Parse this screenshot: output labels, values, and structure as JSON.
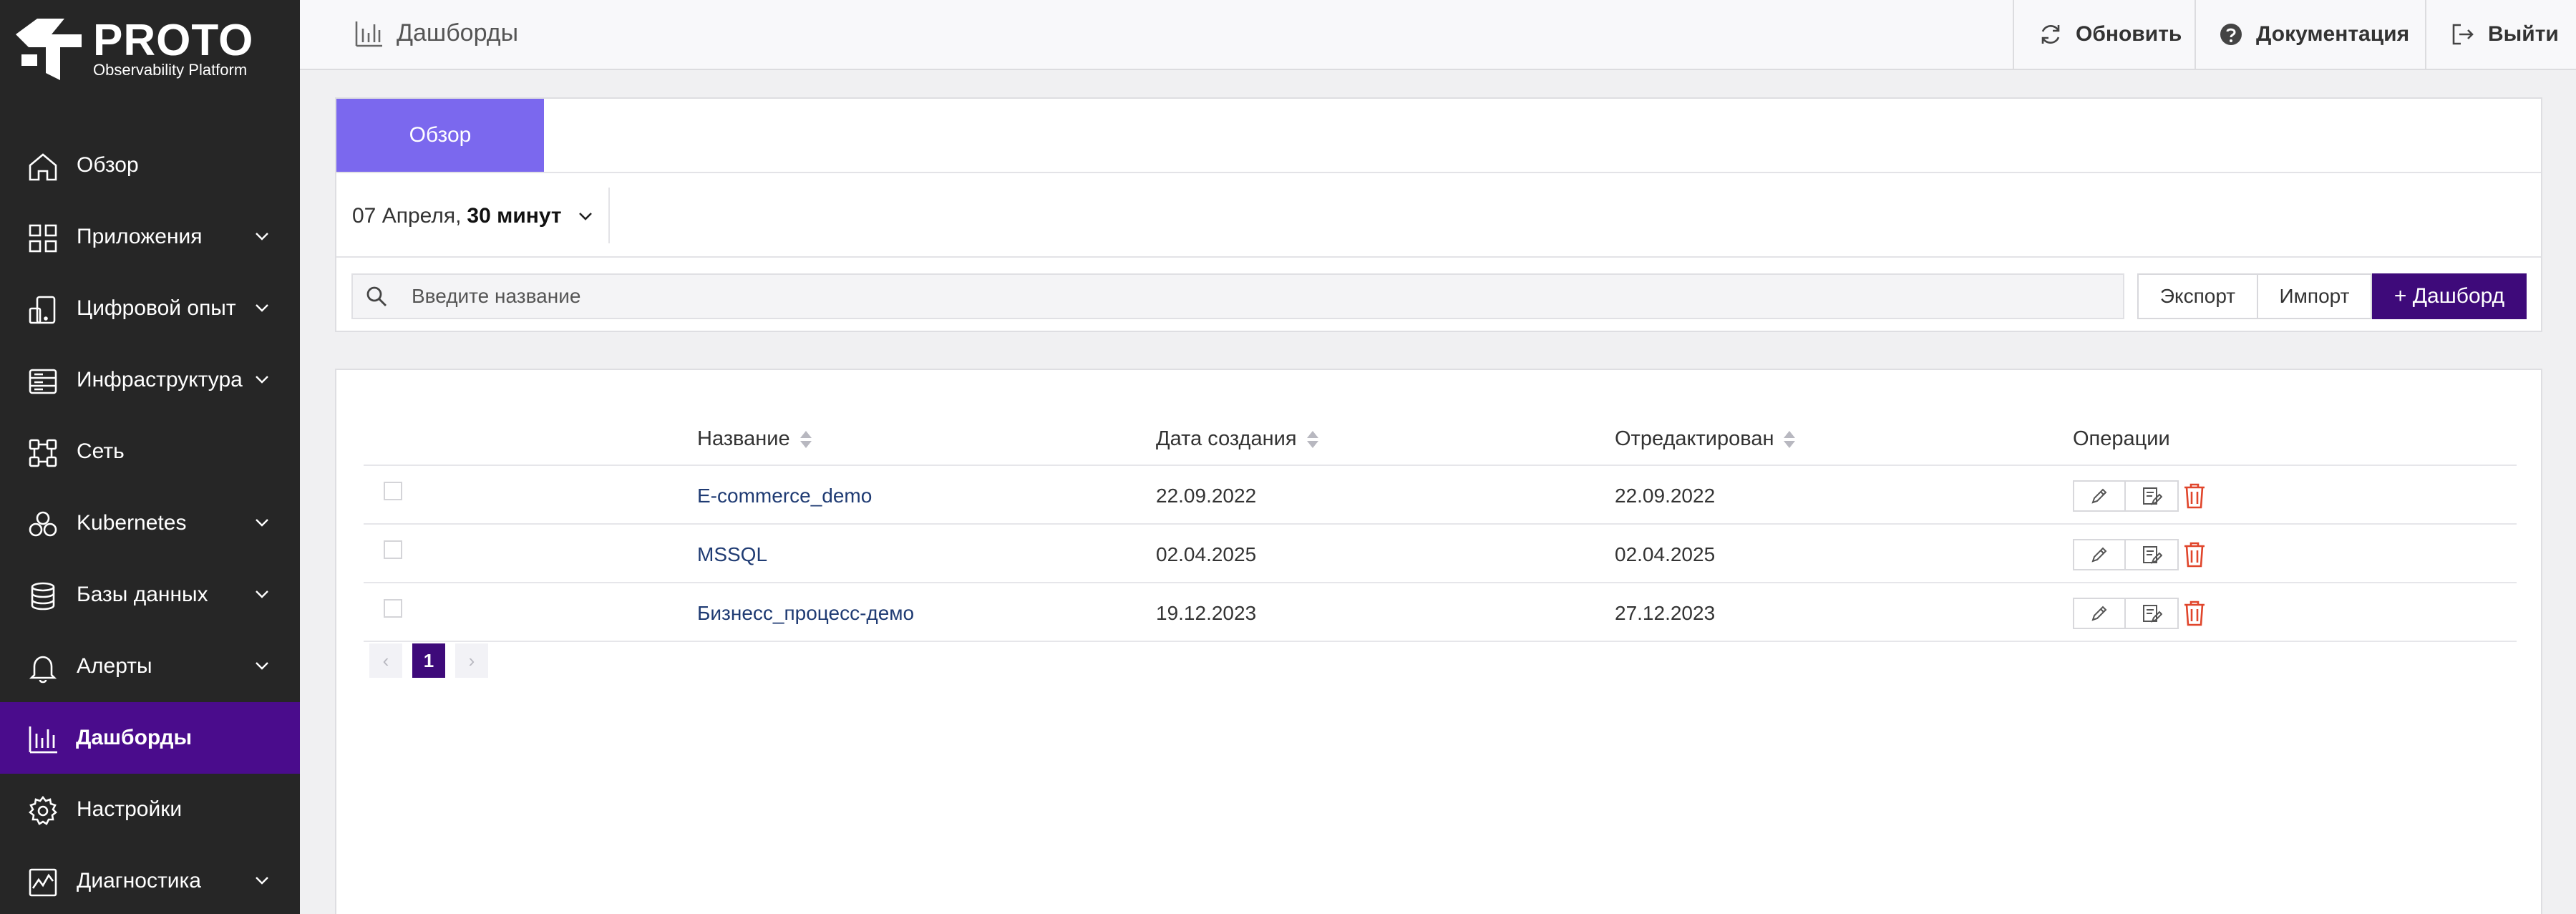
{
  "brand": {
    "title": "PROTO",
    "subtitle": "Observability Platform"
  },
  "sidebar": {
    "items": [
      {
        "label": "Обзор",
        "icon": "home-icon",
        "has_submenu": false,
        "active": false
      },
      {
        "label": "Приложения",
        "icon": "apps-grid-icon",
        "has_submenu": true,
        "active": false
      },
      {
        "label": "Цифровой опыт",
        "icon": "devices-icon",
        "has_submenu": true,
        "active": false
      },
      {
        "label": "Инфраструктура",
        "icon": "server-icon",
        "has_submenu": true,
        "active": false
      },
      {
        "label": "Сеть",
        "icon": "network-icon",
        "has_submenu": false,
        "active": false
      },
      {
        "label": "Kubernetes",
        "icon": "kubernetes-icon",
        "has_submenu": true,
        "active": false
      },
      {
        "label": "Базы данных",
        "icon": "database-icon",
        "has_submenu": true,
        "active": false
      },
      {
        "label": "Алерты",
        "icon": "bell-icon",
        "has_submenu": true,
        "active": false
      },
      {
        "label": "Дашборды",
        "icon": "bar-chart-icon",
        "has_submenu": false,
        "active": true
      },
      {
        "label": "Настройки",
        "icon": "gear-icon",
        "has_submenu": false,
        "active": false
      },
      {
        "label": "Диагностика",
        "icon": "diagnostics-icon",
        "has_submenu": true,
        "active": false
      }
    ]
  },
  "topbar": {
    "title": "Дашборды",
    "refresh_label": "Обновить",
    "docs_label": "Документация",
    "exit_label": "Выйти"
  },
  "tabs": [
    {
      "label": "Обзор",
      "active": true
    }
  ],
  "time_range": {
    "date": "07 Апреля,",
    "duration": "30 минут"
  },
  "search": {
    "placeholder": "Введите название",
    "value": ""
  },
  "actions": {
    "export_label": "Экспорт",
    "import_label": "Импорт",
    "add_label": "+ Дашборд"
  },
  "table": {
    "headers": {
      "name": "Название",
      "created": "Дата создания",
      "edited": "Отредактирован",
      "ops": "Операции"
    },
    "rows": [
      {
        "name": "E-commerce_demo",
        "created": "22.09.2022",
        "edited": "22.09.2022"
      },
      {
        "name": "MSSQL",
        "created": "02.04.2025",
        "edited": "02.04.2025"
      },
      {
        "name": "Бизнесс_процесс-демо",
        "created": "19.12.2023",
        "edited": "27.12.2023"
      }
    ]
  },
  "pagination": {
    "current_page": "1",
    "prev_glyph": "‹",
    "next_glyph": "›"
  },
  "colors": {
    "sidebar_bg": "#262626",
    "active_nav": "#4a0c8c",
    "tab_active": "#7b68ee",
    "primary_button": "#3e0a7a",
    "link": "#1f3b73",
    "delete": "#e0452b"
  }
}
